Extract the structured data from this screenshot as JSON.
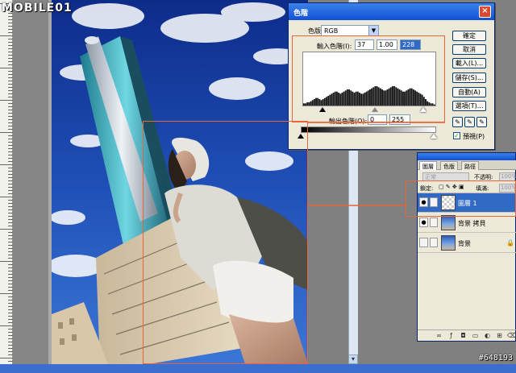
{
  "watermark": {
    "logo": "MOBILE01",
    "id": "#648193"
  },
  "levels_dialog": {
    "title": "色階",
    "close": "×",
    "channel_label": "色版",
    "channel_value": "RGB",
    "input_label": "輸入色階(I):",
    "input_values": [
      "37",
      "1.00",
      "228"
    ],
    "output_label": "輸出色階(O):",
    "output_values": [
      "0",
      "255"
    ],
    "buttons": [
      "確定",
      "取消",
      "載入(L)...",
      "儲存(S)...",
      "自動(A)",
      "選項(T)..."
    ],
    "preview_label": "預視(P)",
    "preview_checked": "✓",
    "histogram": [
      2,
      2,
      3,
      3,
      4,
      5,
      6,
      7,
      7,
      6,
      5,
      6,
      7,
      8,
      9,
      10,
      11,
      12,
      13,
      13,
      12,
      11,
      12,
      13,
      14,
      15,
      15,
      14,
      13,
      12,
      13,
      13,
      12,
      11,
      11,
      12,
      13,
      14,
      15,
      16,
      17,
      18,
      18,
      17,
      16,
      15,
      14,
      14,
      15,
      16,
      17,
      18,
      18,
      17,
      16,
      15,
      14,
      13,
      13,
      14,
      15,
      16,
      16,
      15,
      14,
      13,
      12,
      11,
      10,
      8,
      6,
      4,
      3,
      2,
      2,
      1
    ]
  },
  "layers_panel": {
    "tabs": [
      "圖層",
      "色版",
      "路徑"
    ],
    "blend_mode": "正常",
    "opacity_label": "不透明:",
    "opacity_value": "100%",
    "lock_label": "鎖定:",
    "fill_label": "填滿:",
    "fill_value": "100%",
    "layers": [
      {
        "name": "圖層 1",
        "active": true,
        "visible": "●"
      },
      {
        "name": "背景 拷貝",
        "active": false,
        "visible": "●"
      },
      {
        "name": "背景",
        "active": false,
        "visible": ""
      }
    ],
    "footer_icons": [
      "link-icon",
      "style-icon",
      "mask-icon",
      "set-icon",
      "adjust-icon",
      "new-layer-icon",
      "trash-icon"
    ]
  },
  "colors": {
    "highlight": "#e8643a",
    "selection": "#316ac5",
    "titlebar": "#1150d6"
  }
}
